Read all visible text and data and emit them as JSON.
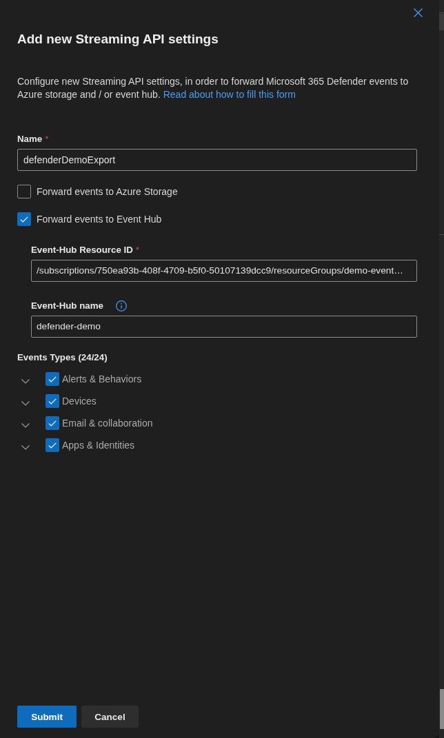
{
  "title": "Add new Streaming API settings",
  "description": {
    "text": "Configure new Streaming API settings, in order to forward Microsoft 365 Defender events to Azure storage and / or event hub.",
    "link": "Read about how to fill this form"
  },
  "name_field": {
    "label": "Name",
    "required_mark": "*",
    "value": "defenderDemoExport"
  },
  "forward_options": [
    {
      "label": "Forward events to Azure Storage",
      "checked": false
    },
    {
      "label": "Forward events to Event Hub",
      "checked": true
    }
  ],
  "event_hub_fields": [
    {
      "label": "Event-Hub Resource ID",
      "required_mark": "*",
      "value": "/subscriptions/750ea93b-408f-4709-b5f0-50107139dcc9/resourceGroups/demo-event…"
    },
    {
      "label": "Event-Hub name",
      "info_icon": true,
      "value": "defender-demo"
    }
  ],
  "event_types": {
    "title": "Events Types (24/24)",
    "items": [
      {
        "label": "Alerts & Behaviors",
        "checked": true,
        "expanded": false
      },
      {
        "label": "Devices",
        "checked": true,
        "expanded": false
      },
      {
        "label": "Email & collaboration",
        "checked": true,
        "expanded": false
      },
      {
        "label": "Apps & Identities",
        "checked": true,
        "expanded": false
      }
    ]
  },
  "buttons": [
    {
      "label": "Submit",
      "kind": "primary"
    },
    {
      "label": "Cancel",
      "kind": "secondary"
    }
  ]
}
